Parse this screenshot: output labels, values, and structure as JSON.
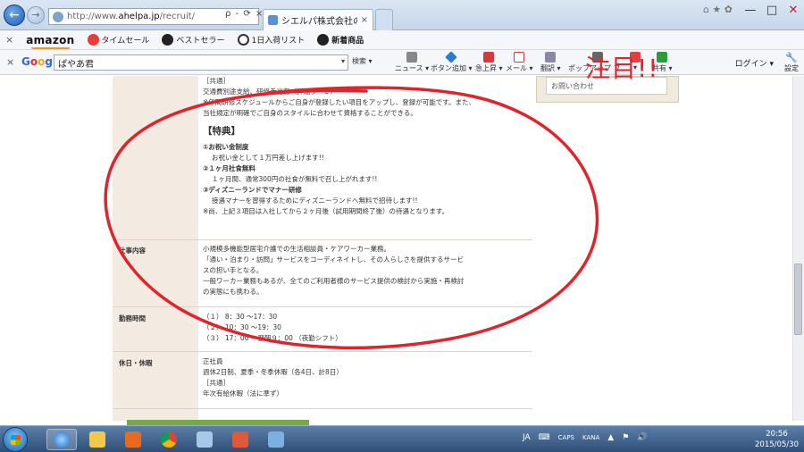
{
  "browser": {
    "address_prefix": "http://www.",
    "address_domain": "ahelpa.jp",
    "address_path": "/recruit/",
    "address_tools": "ρ - ⟳ ×",
    "tab_label": "シエルパ株式会社の求人...",
    "tab_close": "×",
    "new_tab": "",
    "back_icon": "←",
    "forward_icon": "→",
    "minimize": "—",
    "maximize": "□",
    "close": "✕",
    "right_icons": "⌂ ★ ✿"
  },
  "bookmarks": {
    "close": "×",
    "amazon": "amazon",
    "items": [
      {
        "label": "タイムセール",
        "color": "#e83b3b"
      },
      {
        "label": "ベストセラー",
        "color": "#222222"
      },
      {
        "label": "1日入荷リスト",
        "color": "#333333"
      },
      {
        "label": "新着商品",
        "color": "#222222"
      }
    ]
  },
  "google_toolbar": {
    "close": "×",
    "logo": [
      "G",
      "o",
      "o",
      "g",
      "l",
      "e"
    ],
    "query": "ぱやあ君",
    "tools": [
      {
        "label": "検索 ▾",
        "color": "#3a7bd5"
      },
      {
        "label": "ニュース ▾",
        "color": "#888888"
      },
      {
        "label": "ボタン追加 ▾",
        "color": "#2a7bd3"
      },
      {
        "label": "急上昇 ▾",
        "color": "#d93838"
      },
      {
        "label": "メール ▾",
        "color": "#d93838"
      },
      {
        "label": "翻訳 ▾",
        "color": "#8888aa"
      },
      {
        "label": "ポップアップ ブ...",
        "color": "#666666"
      },
      {
        "label": "▾",
        "color": "#e04040"
      },
      {
        "label": "共有 ▾",
        "color": "#2a9d3a"
      }
    ],
    "login": "ログイン ▾",
    "settings": "設定"
  },
  "sidebar_box": {
    "contact": "お問い合わせ"
  },
  "annotation_text": "注目!!",
  "job": {
    "intro_lines": [
      "［共通］",
      "交通費別途支給、研修手当有（詳細ウ・ミ）",
      "※年間研修スケジュールからご自身が登録したい項目をアップし、登録が可能です。また、",
      "当社規定が明確でご自身のスタイルに合わせて資格することができる。"
    ],
    "benefits_heading": "【特典】",
    "benefits": [
      {
        "title": "①お祝い金制度",
        "desc": "お祝い金として１万円差し上げます!!"
      },
      {
        "title": "②１ヶ月社食無料",
        "desc": "１ヶ月間、通常300円の社食が無料で召し上がれます!!"
      },
      {
        "title": "③ディズニーランドでマナー研修",
        "desc": "接遇マナーを習得するためにディズニーランドへ無料で招待します!!"
      }
    ],
    "benefits_note": "※尚、上記３項目は入社してから２ヶ月後（試用期間終了後）の待遇となります。",
    "rows": [
      {
        "label": "仕事内容",
        "lines": [
          "小規模多機能型居宅介護での生活相談員・ケアワーカー業務。",
          "「通い・泊まり・訪問」サービスをコーディネイトし、その人らしさを提供するサービ",
          "スの担い手となる。",
          "一般ワーカー業務もあるが、全てのご利用者様のサービス提供の検討から実施・再検討",
          "の実態にも携わる。"
        ]
      },
      {
        "label": "勤務時間",
        "lines": [
          "（１） 8：30 ～17：30",
          "（２） 10：30 ～19：30",
          "（３） 17：00 ～翌朝９：00 （夜勤シフト）"
        ]
      },
      {
        "label": "休日・休暇",
        "lines": [
          "正社員",
          "週休2日制、夏季・冬季休暇（各4日、計8日）",
          "［共通］",
          "年次有給休暇（法に準ず）"
        ]
      }
    ]
  },
  "taskbar": {
    "tray": [
      "JA",
      "⌨",
      "CAPS",
      "KANA",
      "▲",
      "⚑",
      "🔊"
    ],
    "time": "20:56",
    "date": "2015/05/30"
  },
  "colors": {
    "annotation_red": "#e0242b",
    "label_column": "#f3ebe2",
    "taskbar": "#2f4f78"
  }
}
